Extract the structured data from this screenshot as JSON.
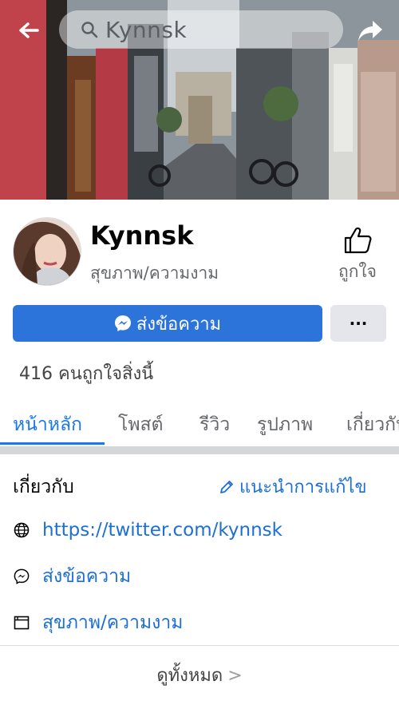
{
  "header": {
    "search_text": "Kynnsk",
    "back_icon": "back-arrow-icon",
    "share_icon": "share-arrow-icon"
  },
  "profile": {
    "name": "Kynnsk",
    "category": "สุขภาพ/ความงาม",
    "like_label": "ถูกใจ",
    "message_button": "ส่งข้อความ",
    "more_button": "···",
    "likes_count": "416 คนถูกใจสิ่งนี้"
  },
  "tabs": [
    {
      "label": "หน้าหลัก",
      "active": true
    },
    {
      "label": "โพสต์",
      "active": false
    },
    {
      "label": "รีวิว",
      "active": false
    },
    {
      "label": "รูปภาพ",
      "active": false
    },
    {
      "label": "เกี่ยวกับ",
      "active": false
    }
  ],
  "about": {
    "title": "เกี่ยวกับ",
    "suggest_edit": "แนะนำการแก้ไข",
    "rows": [
      {
        "icon": "globe-icon",
        "text": "https://twitter.com/kynnsk"
      },
      {
        "icon": "messenger-icon",
        "text": "ส่งข้อความ"
      },
      {
        "icon": "category-icon",
        "text": "สุขภาพ/ความงาม"
      }
    ],
    "see_all": "ดูทั้งหมด"
  },
  "colors": {
    "accent": "#1877f2",
    "button_blue": "#2d74da",
    "secondary_text": "#65676b"
  }
}
